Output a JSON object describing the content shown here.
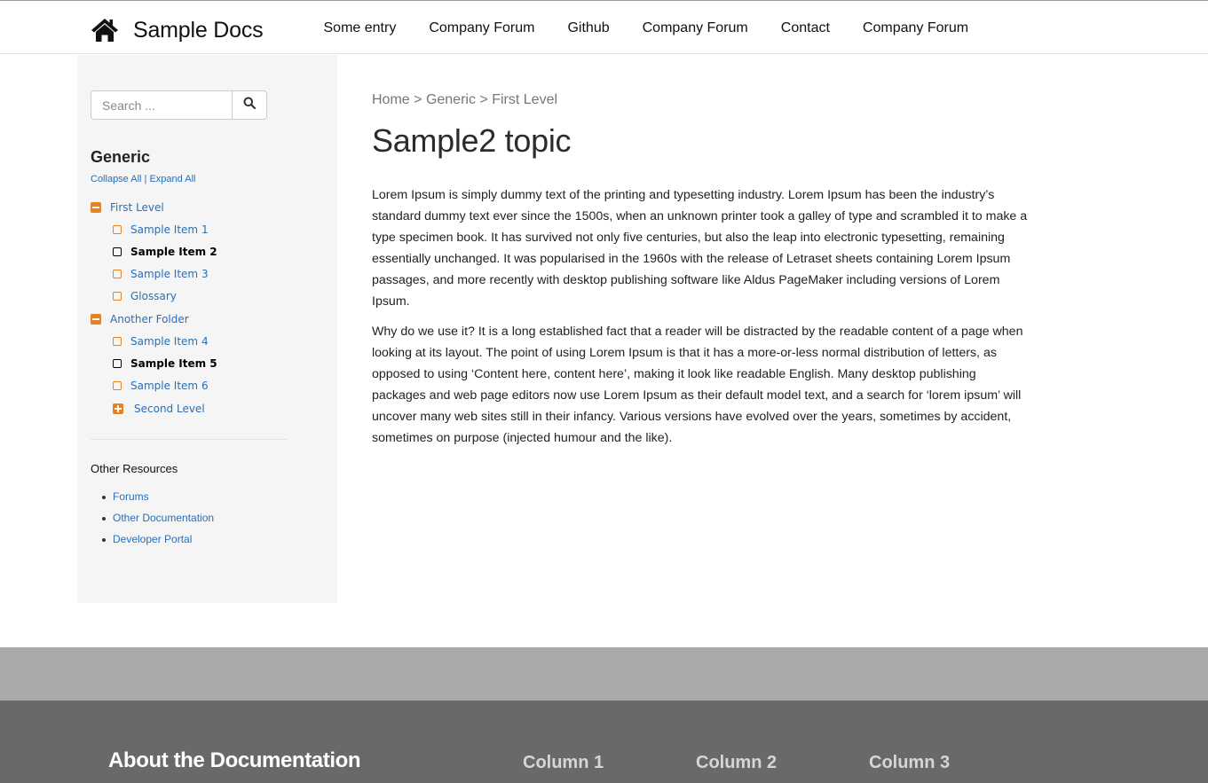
{
  "header": {
    "brand": "Sample Docs",
    "nav": [
      "Some entry",
      "Company Forum",
      "Github",
      "Company Forum",
      "Contact",
      "Company Forum"
    ]
  },
  "sidebar": {
    "search_placeholder": "Search ...",
    "title": "Generic",
    "collapse_all": "Collapse All",
    "separator": "|",
    "expand_all": "Expand All",
    "tree": [
      {
        "label": "First Level",
        "kind": "folder-expanded"
      },
      {
        "label": "Sample Item 1",
        "kind": "item"
      },
      {
        "label": "Sample Item 2",
        "kind": "item-active"
      },
      {
        "label": "Sample Item 3",
        "kind": "item"
      },
      {
        "label": "Glossary",
        "kind": "item"
      },
      {
        "label": "Another Folder",
        "kind": "folder-expanded"
      },
      {
        "label": "Sample Item 4",
        "kind": "item"
      },
      {
        "label": "Sample Item 5",
        "kind": "item-active"
      },
      {
        "label": "Sample Item 6",
        "kind": "item"
      },
      {
        "label": "Second Level",
        "kind": "folder-collapsed"
      }
    ],
    "resources_title": "Other Resources",
    "resources": [
      "Forums",
      "Other Documentation",
      "Developer Portal"
    ]
  },
  "main": {
    "breadcrumb": [
      "Home",
      "Generic",
      "First Level"
    ],
    "breadcrumb_sep": ">",
    "title": "Sample2 topic",
    "paragraphs": [
      "Lorem Ipsum is simply dummy text of the printing and typesetting industry. Lorem Ipsum has been the industry’s standard dummy text ever since the 1500s, when an unknown printer took a galley of type and scrambled it to make a type specimen book. It has survived not only five centuries, but also the leap into electronic typesetting, remaining essentially unchanged. It was popularised in the 1960s with the release of Letraset sheets containing Lorem Ipsum passages, and more recently with desktop publishing software like Aldus PageMaker including versions of Lorem Ipsum.",
      "Why do we use it? It is a long established fact that a reader will be distracted by the readable content of a page when looking at its layout. The point of using Lorem Ipsum is that it has a more-or-less normal distribution of letters, as opposed to using ‘Content here, content here’, making it look like readable English. Many desktop publishing packages and web page editors now use Lorem Ipsum as their default model text, and a search for ‘lorem ipsum’ will uncover many web sites still in their infancy. Various versions have evolved over the years, sometimes by accident, sometimes on purpose (injected humour and the like)."
    ]
  },
  "footer": {
    "title": "About the Documentation",
    "columns": [
      "Column 1",
      "Column 2",
      "Column 3"
    ]
  },
  "colors": {
    "link": "#2a6eb5",
    "accent": "#e8821e",
    "sidebar_bg": "#f5f5f5",
    "footer_band": "#a9a9a9",
    "footer_bg": "#696969"
  },
  "icons": {
    "brand": "home-icon",
    "search": "search-icon",
    "folder_expanded": "minus-square-icon",
    "folder_collapsed": "plus-square-icon",
    "item": "square-outline-icon"
  }
}
